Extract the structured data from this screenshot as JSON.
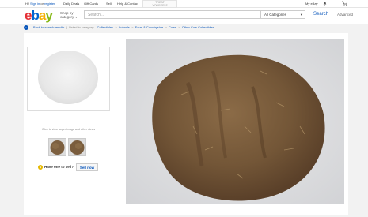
{
  "topbar": {
    "greeting_hi": "Hi!",
    "sign_in": "Sign in",
    "or": "or",
    "register": "register",
    "daily_deals": "Daily Deals",
    "gift_cards": "Gift Cards",
    "sell": "Sell",
    "help_contact": "Help & Contact",
    "promo_line1": "TREAT",
    "promo_line2": "YOURSELF",
    "my_ebay": "My eBay"
  },
  "header": {
    "logo": [
      "e",
      "b",
      "a",
      "y"
    ],
    "shop_by_line1": "Shop by",
    "shop_by_line2": "category",
    "search_placeholder": "Search...",
    "category_select": "All Categories",
    "search_button": "Search",
    "advanced": "Advanced"
  },
  "breadcrumbs": {
    "back": "Back to search results",
    "listed_in": "Listed in category:",
    "items": [
      "Collectibles",
      "Animals",
      "Farm & Countryside",
      "Cows",
      "Other Cow Collectibles"
    ]
  },
  "gallery": {
    "caption": "Click to view larger image and other views"
  },
  "sell_prompt": {
    "question": "Have one to sell?",
    "button": "Sell now"
  },
  "colors": {
    "logo_e": "#e53238",
    "logo_b": "#0064d2",
    "logo_a": "#f5af02",
    "logo_y": "#86b817",
    "link": "#0654ba",
    "page_bg": "#f2f2f2"
  }
}
